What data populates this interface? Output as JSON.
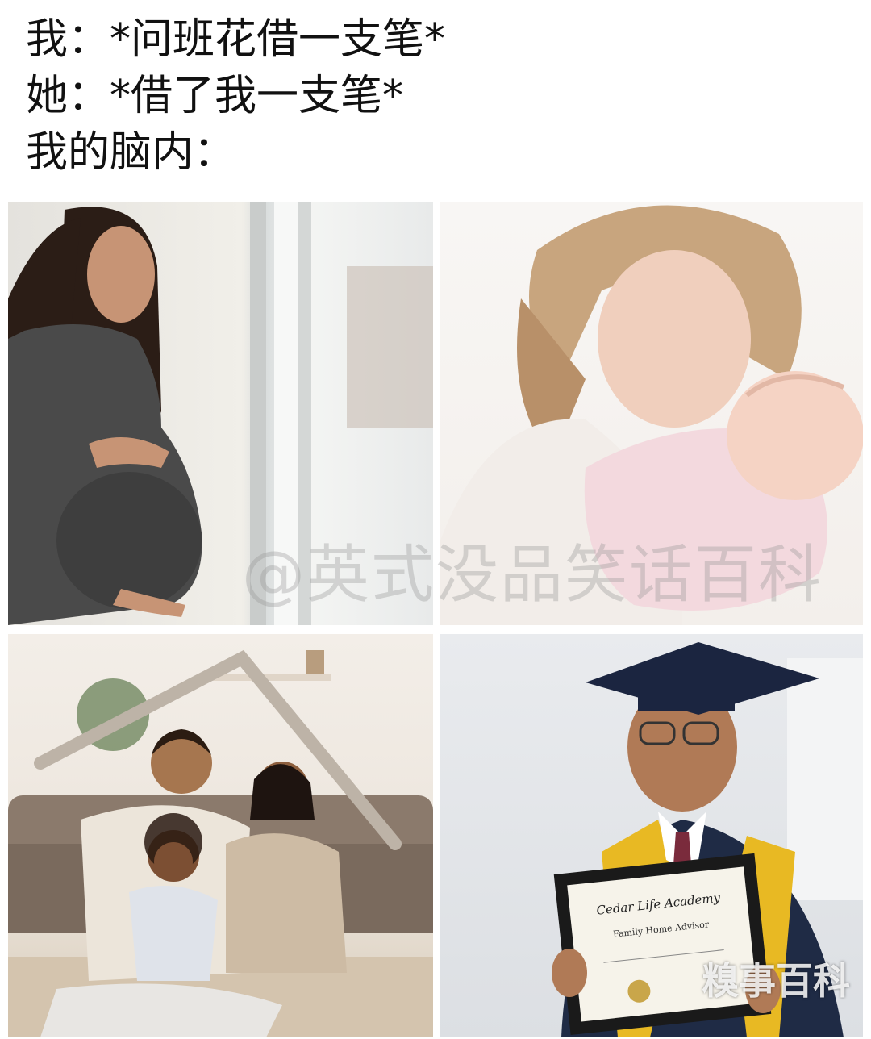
{
  "caption": {
    "line1": "我：*问班花借一支笔*",
    "line2": "她：*借了我一支笔*",
    "line3": "我的脑内："
  },
  "panels": [
    {
      "id": "pregnant-woman-photo"
    },
    {
      "id": "mother-holding-baby-photo"
    },
    {
      "id": "family-under-roof-photo"
    },
    {
      "id": "child-graduation-photo",
      "diploma_title": "Cedar Life Academy",
      "diploma_name": "Family Home Advisor"
    }
  ],
  "watermarks": {
    "main": "@英式没品笑话百科",
    "corner": "糗事百科"
  },
  "colors": {
    "graduation_gown": "#1f2b45",
    "stole": "#e8b923"
  }
}
